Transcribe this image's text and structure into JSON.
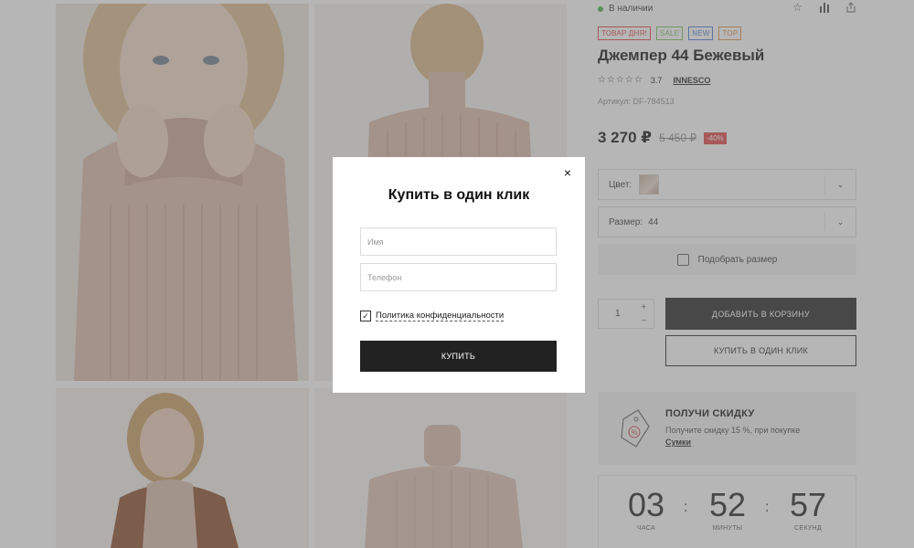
{
  "product": {
    "stock_text": "В наличии",
    "badges": [
      {
        "label": "ТОВАР ДНЯ!",
        "color": "#e04545"
      },
      {
        "label": "SALE",
        "color": "#7cbf5a"
      },
      {
        "label": "NEW",
        "color": "#4a7fd4"
      },
      {
        "label": "TOP",
        "color": "#e0914a"
      }
    ],
    "title": "Джемпер 44 Бежевый",
    "rating_stars": "☆☆☆☆☆",
    "rating_value": "3.7",
    "brand": "INNESCO",
    "sku": "Артикул: DF-784513",
    "price": "3 270 ₽",
    "old_price": "5 450 ₽",
    "discount": "-40%",
    "color_label": "Цвет:",
    "size_label": "Размер:",
    "size_value": "44",
    "fit_button": "Подобрать размер",
    "quantity": "1",
    "qty_plus": "+",
    "qty_minus": "–",
    "add_to_cart": "ДОБАВИТЬ В КОРЗИНУ",
    "one_click": "КУПИТЬ В ОДИН КЛИК",
    "icons": [
      "star-icon",
      "compare-icon",
      "share-icon"
    ]
  },
  "promo": {
    "title": "ПОЛУЧИ СКИДКУ",
    "text": "Получите скидку 15 %, при покупке",
    "link": "Сумки"
  },
  "timer": {
    "hours": "03",
    "hours_label": "ЧАСА",
    "minutes": "52",
    "minutes_label": "МИНУТЫ",
    "seconds": "57",
    "seconds_label": "СЕКУНД",
    "separator": ":"
  },
  "modal": {
    "title": "Купить в один клик",
    "close": "×",
    "name_placeholder": "Имя",
    "phone_placeholder": "Телефон",
    "policy_checked": true,
    "policy_text": "Политика конфиденциальности",
    "buy_button": "КУПИТЬ"
  },
  "colors": {
    "accent_dark": "#222222",
    "in_stock": "#42b549",
    "discount": "#e04545"
  }
}
